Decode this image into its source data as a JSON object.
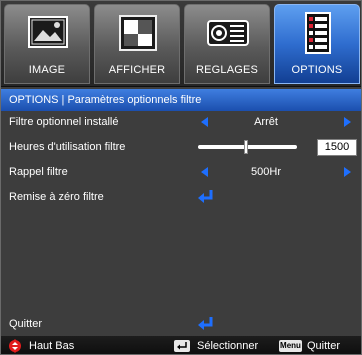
{
  "tabs": [
    {
      "label": "IMAGE",
      "icon": "picture-icon",
      "active": false
    },
    {
      "label": "AFFICHER",
      "icon": "display-icon",
      "active": false
    },
    {
      "label": "REGLAGES",
      "icon": "projector-icon",
      "active": false
    },
    {
      "label": "OPTIONS",
      "icon": "options-list-icon",
      "active": true
    }
  ],
  "title": "OPTIONS | Paramètres optionnels filtre",
  "rows": {
    "filter_installed": {
      "label": "Filtre optionnel installé",
      "value": "Arrêt"
    },
    "filter_hours": {
      "label": "Heures d'utilisation filtre",
      "value": "1500",
      "level": 0.48
    },
    "filter_reminder": {
      "label": "Rappel filtre",
      "value": "500Hr"
    },
    "filter_reset": {
      "label": "Remise à zéro filtre"
    }
  },
  "quit": {
    "label": "Quitter"
  },
  "footer": {
    "nav_label": "Haut Bas",
    "select_label": "Sélectionner",
    "menu_key": "Menu",
    "quit_label": "Quitter"
  },
  "colors": {
    "accent_blue": "#1e6fff",
    "nav_red": "#e21c1c",
    "background": "#3d3d3d"
  }
}
